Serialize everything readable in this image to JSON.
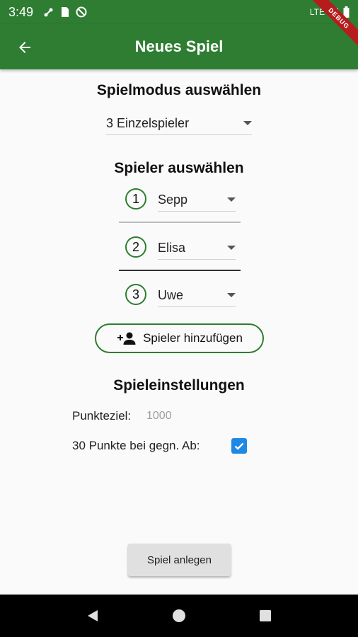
{
  "status_bar": {
    "time": "3:49",
    "network_label": "LTE",
    "icons": [
      "cast-icon",
      "sim-icon",
      "do-not-disturb-icon",
      "signal-icon",
      "battery-icon"
    ]
  },
  "debug_banner": "DEBUG",
  "app_bar": {
    "title": "Neues Spiel",
    "back_icon": "arrow-back-icon"
  },
  "game_mode": {
    "heading": "Spielmodus auswählen",
    "selected": "3 Einzelspieler"
  },
  "players": {
    "heading": "Spieler auswählen",
    "list": [
      {
        "number": "1",
        "name": "Sepp"
      },
      {
        "number": "2",
        "name": "Elisa"
      },
      {
        "number": "3",
        "name": "Uwe"
      }
    ],
    "add_button_label": "Spieler hinzufügen",
    "add_icon": "person-add-icon"
  },
  "settings": {
    "heading": "Spieleinstellungen",
    "target_label": "Punkteziel:",
    "target_placeholder": "1000",
    "bonus_label": "30 Punkte bei gegn. Ab:",
    "bonus_checked": true
  },
  "create_button_label": "Spiel anlegen",
  "colors": {
    "primary": "#2e7d32",
    "checkbox": "#1e88e5",
    "debug": "#b71c1c"
  }
}
